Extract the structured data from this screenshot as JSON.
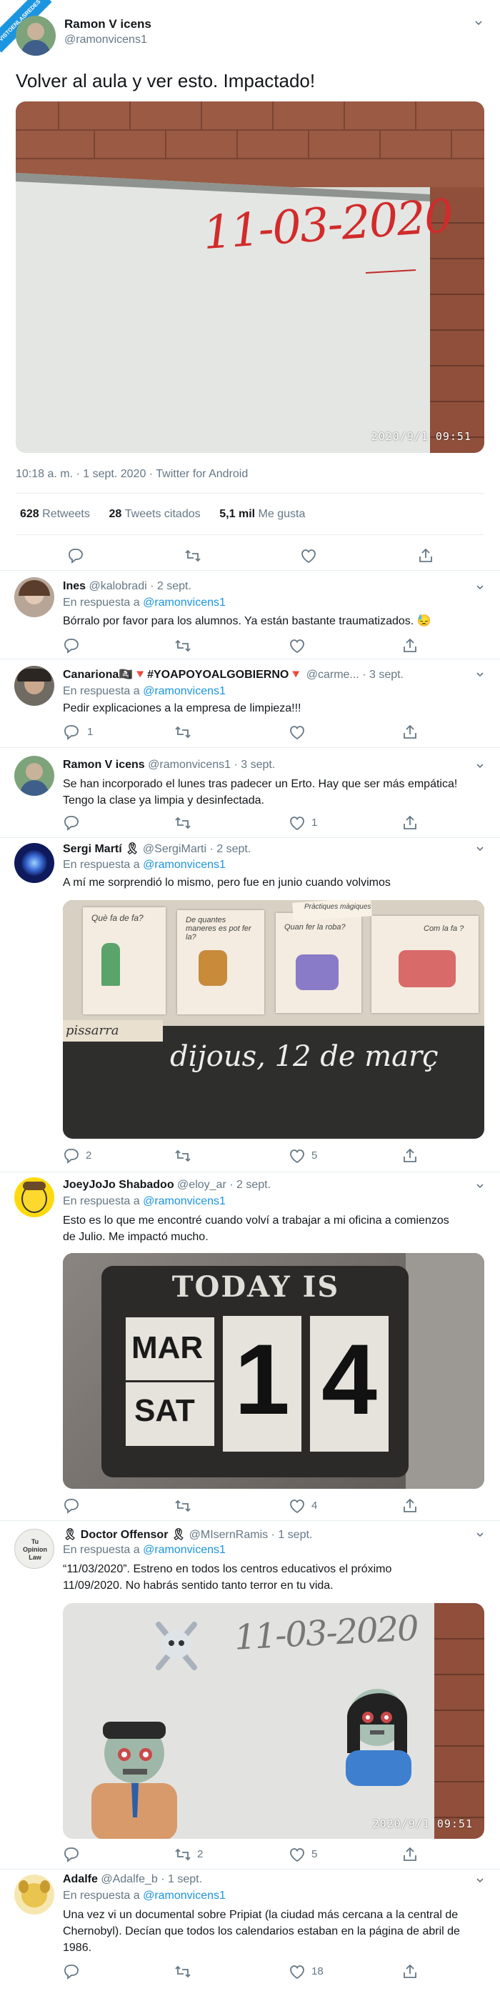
{
  "badge": {
    "text": "VISTOENLASREDES .COM",
    "color": "#1b95e0"
  },
  "main": {
    "name": "Ramon V icens",
    "handle": "@ramonvicens1",
    "text": "Volver al aula y ver esto. Impactado!",
    "board_text": "11-03-2020",
    "photo_stamp": "2020/9/1  09:51",
    "meta": "10:18 a. m. · 1 sept. 2020 · Twitter for Android",
    "stats": {
      "retweets_count": "628",
      "retweets_label": "Retweets",
      "quotes_count": "28",
      "quotes_label": "Tweets citados",
      "likes_count": "5,1 mil",
      "likes_label": "Me gusta"
    }
  },
  "reply_prefix": "En respuesta a",
  "replies": [
    {
      "name": "Ines",
      "meta": "@kalobradi · 2 sept.",
      "reply_to": "@ramonvicens1",
      "text": "Bórralo por favor para los alumnos. Ya están bastante traumatizados. 😓",
      "reply_count": "",
      "retweet_count": "",
      "like_count": ""
    },
    {
      "name": "Canariona🏴‍☠️🔻#YOAPOYOALGOBIERNO🔻",
      "meta": "@carme... · 3 sept.",
      "reply_to": "@ramonvicens1",
      "text": "Pedir explicaciones a la empresa de limpieza!!!",
      "reply_count": "1",
      "retweet_count": "",
      "like_count": ""
    },
    {
      "name": "Ramon V icens",
      "meta": "@ramonvicens1 · 3 sept.",
      "reply_to": "",
      "text": "Se han incorporado el lunes tras  padecer un Erto. Hay que ser más empática! Tengo la clase ya limpia y desinfectada.",
      "reply_count": "",
      "retweet_count": "",
      "like_count": "1"
    },
    {
      "name": "Sergi Martí 🎗",
      "meta": "@SergiMarti · 2 sept.",
      "reply_to": "@ramonvicens1",
      "text": "A mí me sorprendió lo mismo, pero fue en junio cuando volvimos",
      "photo_labels": [
        "Què fa de fa?",
        "De quantes maneres es pot fer la?",
        "Quan fer la roba?",
        "Com la fa ?",
        "pissarra",
        "dijous, 12 de març",
        "Pràctiques màgiques"
      ],
      "reply_count": "2",
      "retweet_count": "",
      "like_count": "5"
    },
    {
      "name": "JoeyJoJo Shabadoo",
      "meta": "@eloy_ar · 2 sept.",
      "reply_to": "@ramonvicens1",
      "text": "Esto es lo que me encontré cuando volví a trabajar a mi oficina a comienzos de Julio. Me impactó mucho.",
      "photo_labels": [
        "TODAY IS",
        "MAR",
        "SAT",
        "1",
        "4"
      ],
      "reply_count": "",
      "retweet_count": "",
      "like_count": "4"
    },
    {
      "name": "🎗 Doctor Offensor 🎗",
      "meta": "@MIsernRamis · 1 sept.",
      "reply_to": "@ramonvicens1",
      "text": "“11/03/2020”. Estreno en todos los centros educativos el próximo 11/09/2020. No habrás sentido tanto terror en tu vida.",
      "photo_labels": [
        "11-03-2020",
        "2020/9/1  09:51"
      ],
      "avatar_text": "Tu Opinion Law",
      "reply_count": "",
      "retweet_count": "2",
      "like_count": "5"
    },
    {
      "name": "Adalfe",
      "meta": "@Adalfe_b · 1 sept.",
      "reply_to": "@ramonvicens1",
      "text": "Una vez vi un documental sobre Pripiat (la ciudad más cercana a la central de Chernobyl). Decían que todos los calendarios estaban en la página de abril de 1986.",
      "reply_count": "",
      "retweet_count": "",
      "like_count": "18"
    }
  ]
}
